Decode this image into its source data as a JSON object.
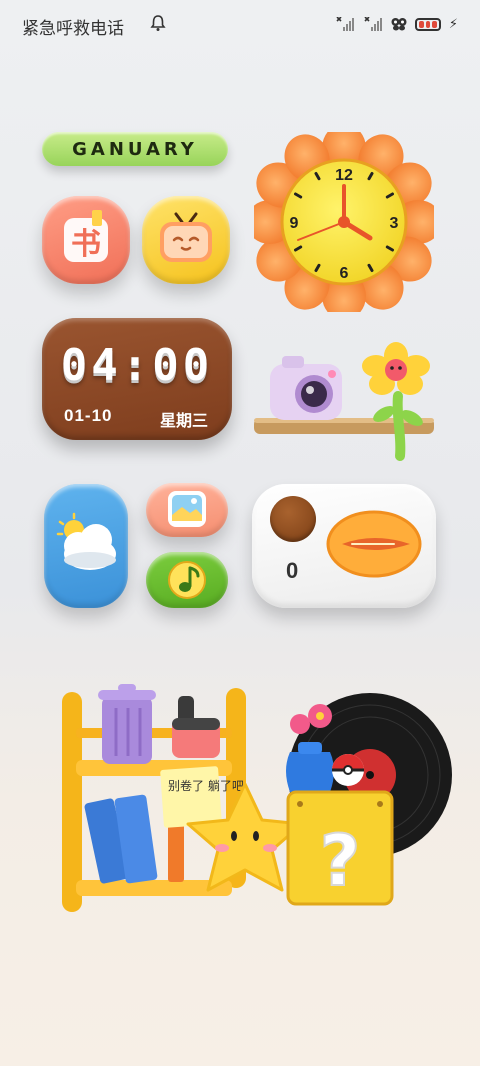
{
  "status_bar": {
    "emergency_text": "紧急呼救电话",
    "icons": [
      "bell-icon",
      "signal-off-icon",
      "signal-off-icon",
      "butterfly-icon",
      "battery-icon",
      "charging-bolt-icon"
    ]
  },
  "month_widget": {
    "label": "GANUARY"
  },
  "clock_widget": {
    "numbers": [
      "12",
      "3",
      "6",
      "9"
    ]
  },
  "time_widget": {
    "time": "04:00",
    "date": "01-10",
    "weekday": "星期三"
  },
  "counter_widget": {
    "count": "0"
  },
  "sticky_note": {
    "text": "别卷了 躺了吧"
  },
  "apps": [
    "book-app-icon",
    "tv-app-icon",
    "weather-widget",
    "gallery-app-icon",
    "music-app-icon"
  ],
  "colors": {
    "green_pill": "#a8dd6a",
    "brown_widget": "#8a4624",
    "weather_blue": "#4aa3e6",
    "music_green": "#66b82c",
    "book_red": "#f3806a",
    "tv_yellow": "#f8d12f"
  }
}
